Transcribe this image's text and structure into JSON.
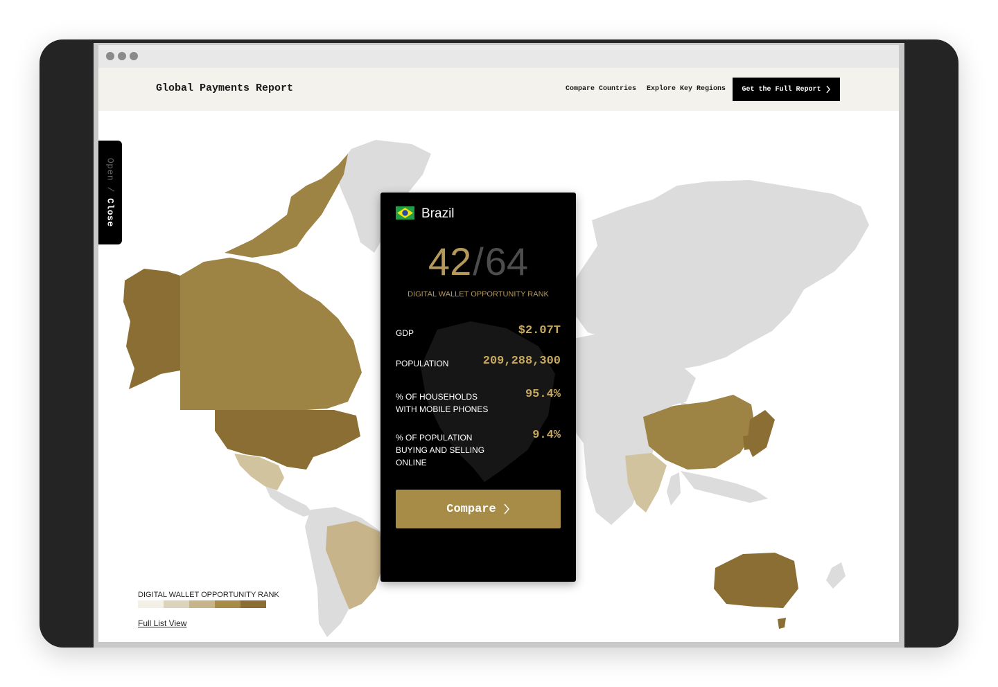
{
  "brand": "Global Payments Report",
  "nav": {
    "compare_countries": "Compare Countries",
    "explore_regions": "Explore Key Regions",
    "cta": "Get the Full Report"
  },
  "side_tab": {
    "open": "Open",
    "separator": "/",
    "close": "Close"
  },
  "card": {
    "country": "Brazil",
    "rank": "42",
    "rank_separator": "/",
    "rank_total": "64",
    "rank_label": "DIGITAL WALLET OPPORTUNITY RANK",
    "stats": [
      {
        "label_lines": [
          "GDP"
        ],
        "value": "$2.07T"
      },
      {
        "label_lines": [
          "POPULATION"
        ],
        "value": "209,288,300"
      },
      {
        "label_lines": [
          "% OF HOUSEHOLDS",
          "WITH MOBILE PHONES"
        ],
        "value": "95.4%"
      },
      {
        "label_lines": [
          "% OF POPULATION",
          "BUYING AND SELLING",
          "ONLINE"
        ],
        "value": "9.4%"
      }
    ],
    "compare_button": "Compare"
  },
  "legend": {
    "title": "DIGITAL WALLET OPPORTUNITY RANK",
    "colors": [
      "#f3f1e6",
      "#dcd3bd",
      "#c7b48a",
      "#a78c48",
      "#8a6e34"
    ]
  },
  "full_list_link": "Full List View",
  "colors": {
    "accent_gold": "#a78c48",
    "dark_gold": "#8a6e34",
    "light_tan": "#d2c39f",
    "land_grey": "#dcdcdc"
  },
  "icons": {
    "chevron": "chevron-right-icon",
    "flag": "brazil-flag-icon"
  }
}
